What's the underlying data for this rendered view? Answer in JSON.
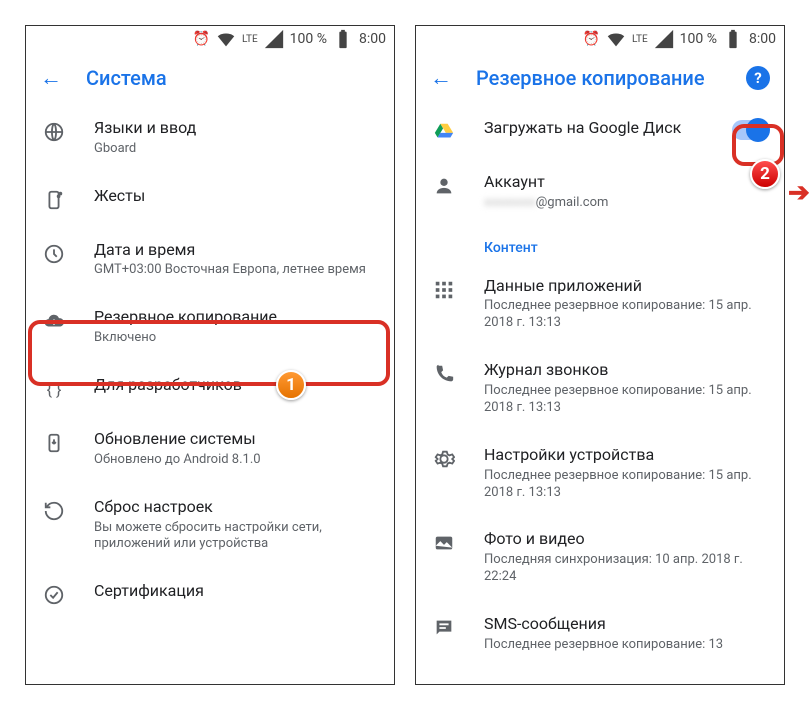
{
  "status": {
    "battery": "100 %",
    "time": "8:00",
    "lte": "LTE"
  },
  "left": {
    "title": "Система",
    "items": [
      {
        "p": "Языки и ввод",
        "s": "Gboard"
      },
      {
        "p": "Жесты"
      },
      {
        "p": "Дата и время",
        "s": "GMT+03:00 Восточная Европа, летнее время"
      },
      {
        "p": "Резервное копирование",
        "s": "Включено"
      },
      {
        "p": "Для разработчиков"
      },
      {
        "p": "Обновление системы",
        "s": "Обновлено до Android 8.1.0"
      },
      {
        "p": "Сброс настроек",
        "s": "Вы можете сбросить настройки сети, приложений или устройства"
      },
      {
        "p": "Сертификация"
      }
    ]
  },
  "right": {
    "title": "Резервное копирование",
    "upload": "Загружать на Google Диск",
    "account_label": "Аккаунт",
    "account_value": "@gmail.com",
    "section": "Контент",
    "content": [
      {
        "p": "Данные приложений",
        "s": "Последнее резервное копирование: 15 апр. 2018 г. 13:13"
      },
      {
        "p": "Журнал звонков",
        "s": "Последнее резервное копирование: 15 апр. 2018 г. 13:13"
      },
      {
        "p": "Настройки устройства",
        "s": "Последнее резервное копирование: 15 апр. 2018 г. 13:13"
      },
      {
        "p": "Фото и видео",
        "s": "Последняя синхронизация: 10 апр. 2018 г. 22:24"
      },
      {
        "p": "SMS-сообщения",
        "s": "Последнее резервное копирование: 13"
      }
    ]
  },
  "badges": {
    "one": "1",
    "two": "2"
  }
}
